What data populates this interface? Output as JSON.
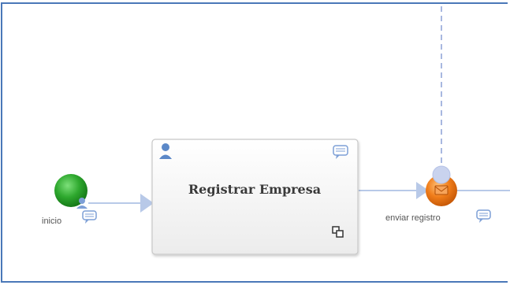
{
  "diagram": {
    "start_event": {
      "label": "inicio",
      "color": "#2ea82e",
      "icons": [
        "person-icon",
        "comment-icon"
      ]
    },
    "task": {
      "label": "Registrar Empresa",
      "icons": [
        "person-icon",
        "comment-icon",
        "multi-instance-icon"
      ]
    },
    "intermediate_event": {
      "label": "enviar registro",
      "color": "#f07d1a",
      "icons": [
        "envelope-icon",
        "comment-icon"
      ]
    },
    "colors": {
      "flow_line": "#b8c9e8",
      "dashed_line": "#a8b8e0",
      "frame_border": "#4a78b8"
    }
  }
}
